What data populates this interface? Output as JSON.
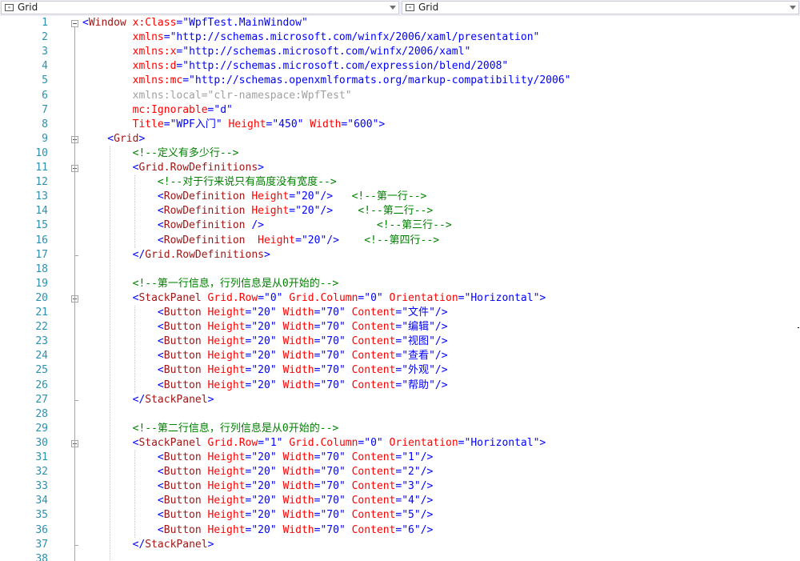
{
  "navbar": {
    "left_combo": {
      "icon": "xaml-element-icon",
      "label": "Grid"
    },
    "right_combo": {
      "icon": "xaml-element-icon",
      "label": "Grid"
    }
  },
  "line_numbers": [
    "1",
    "2",
    "3",
    "4",
    "5",
    "6",
    "7",
    "8",
    "9",
    "10",
    "11",
    "12",
    "13",
    "14",
    "15",
    "16",
    "17",
    "18",
    "19",
    "20",
    "21",
    "22",
    "23",
    "24",
    "25",
    "26",
    "27",
    "28",
    "29",
    "30",
    "31",
    "32",
    "33",
    "34",
    "35",
    "36",
    "37",
    "38"
  ],
  "code_lines": [
    [
      [
        "p",
        "<"
      ],
      [
        "el",
        "Window"
      ],
      [
        "at",
        " x:Class"
      ],
      [
        "p",
        "=\""
      ],
      [
        "v",
        "WpfTest.MainWindow"
      ],
      [
        "p",
        "\""
      ]
    ],
    [
      [
        "at",
        "        xmlns"
      ],
      [
        "p",
        "=\""
      ],
      [
        "v",
        "http://schemas.microsoft.com/winfx/2006/xaml/presentation"
      ],
      [
        "p",
        "\""
      ]
    ],
    [
      [
        "at",
        "        xmlns:x"
      ],
      [
        "p",
        "=\""
      ],
      [
        "v",
        "http://schemas.microsoft.com/winfx/2006/xaml"
      ],
      [
        "p",
        "\""
      ]
    ],
    [
      [
        "at",
        "        xmlns:d"
      ],
      [
        "p",
        "=\""
      ],
      [
        "v",
        "http://schemas.microsoft.com/expression/blend/2008"
      ],
      [
        "p",
        "\""
      ]
    ],
    [
      [
        "at",
        "        xmlns:mc"
      ],
      [
        "p",
        "=\""
      ],
      [
        "v",
        "http://schemas.openxmlformats.org/markup-compatibility/2006"
      ],
      [
        "p",
        "\""
      ]
    ],
    [
      [
        "g",
        "        xmlns:local=\"clr-namespace:WpfTest\""
      ]
    ],
    [
      [
        "at",
        "        mc:Ignorable"
      ],
      [
        "p",
        "=\""
      ],
      [
        "v",
        "d"
      ],
      [
        "p",
        "\""
      ]
    ],
    [
      [
        "at",
        "        Title"
      ],
      [
        "p",
        "=\""
      ],
      [
        "v",
        "WPF入门"
      ],
      [
        "p",
        "\""
      ],
      [
        "at",
        " Height"
      ],
      [
        "p",
        "=\""
      ],
      [
        "v",
        "450"
      ],
      [
        "p",
        "\""
      ],
      [
        "at",
        " Width"
      ],
      [
        "p",
        "=\""
      ],
      [
        "v",
        "600"
      ],
      [
        "p",
        "\">"
      ]
    ],
    [
      [
        "p",
        "    <"
      ],
      [
        "el",
        "Grid"
      ],
      [
        "p",
        ">"
      ]
    ],
    [
      [
        "c",
        "        <!--定义有多少行-->"
      ]
    ],
    [
      [
        "p",
        "        <"
      ],
      [
        "el",
        "Grid.RowDefinitions"
      ],
      [
        "p",
        ">"
      ]
    ],
    [
      [
        "c",
        "            <!--对于行来说只有高度没有宽度-->"
      ]
    ],
    [
      [
        "p",
        "            <"
      ],
      [
        "el",
        "RowDefinition"
      ],
      [
        "at",
        " Height"
      ],
      [
        "p",
        "=\""
      ],
      [
        "v",
        "20"
      ],
      [
        "p",
        "\"/>"
      ],
      [
        "t",
        "   "
      ],
      [
        "c",
        "<!--第一行-->"
      ]
    ],
    [
      [
        "p",
        "            <"
      ],
      [
        "el",
        "RowDefinition"
      ],
      [
        "at",
        " Height"
      ],
      [
        "p",
        "=\""
      ],
      [
        "v",
        "20"
      ],
      [
        "p",
        "\"/>"
      ],
      [
        "t",
        "    "
      ],
      [
        "c",
        "<!--第二行-->"
      ]
    ],
    [
      [
        "p",
        "            <"
      ],
      [
        "el",
        "RowDefinition"
      ],
      [
        "p",
        " />"
      ],
      [
        "t",
        "                  "
      ],
      [
        "c",
        "<!--第三行-->"
      ]
    ],
    [
      [
        "p",
        "            <"
      ],
      [
        "el",
        "RowDefinition"
      ],
      [
        "at",
        "  Height"
      ],
      [
        "p",
        "=\""
      ],
      [
        "v",
        "20"
      ],
      [
        "p",
        "\"/>"
      ],
      [
        "t",
        "    "
      ],
      [
        "c",
        "<!--第四行-->"
      ]
    ],
    [
      [
        "p",
        "        </"
      ],
      [
        "el",
        "Grid.RowDefinitions"
      ],
      [
        "p",
        ">"
      ]
    ],
    [
      [
        "t",
        ""
      ]
    ],
    [
      [
        "c",
        "        <!--第一行信息，行列信息是从0开始的-->"
      ]
    ],
    [
      [
        "p",
        "        <"
      ],
      [
        "el",
        "StackPanel"
      ],
      [
        "at",
        " Grid.Row"
      ],
      [
        "p",
        "=\""
      ],
      [
        "v",
        "0"
      ],
      [
        "p",
        "\""
      ],
      [
        "at",
        " Grid.Column"
      ],
      [
        "p",
        "=\""
      ],
      [
        "v",
        "0"
      ],
      [
        "p",
        "\""
      ],
      [
        "at",
        " Orientation"
      ],
      [
        "p",
        "=\""
      ],
      [
        "v",
        "Horizontal"
      ],
      [
        "p",
        "\">"
      ]
    ],
    [
      [
        "p",
        "            <"
      ],
      [
        "el",
        "Button"
      ],
      [
        "at",
        " Height"
      ],
      [
        "p",
        "=\""
      ],
      [
        "v",
        "20"
      ],
      [
        "p",
        "\""
      ],
      [
        "at",
        " Width"
      ],
      [
        "p",
        "=\""
      ],
      [
        "v",
        "70"
      ],
      [
        "p",
        "\""
      ],
      [
        "at",
        " Content"
      ],
      [
        "p",
        "=\""
      ],
      [
        "v",
        "文件"
      ],
      [
        "p",
        "\"/>"
      ]
    ],
    [
      [
        "p",
        "            <"
      ],
      [
        "el",
        "Button"
      ],
      [
        "at",
        " Height"
      ],
      [
        "p",
        "=\""
      ],
      [
        "v",
        "20"
      ],
      [
        "p",
        "\""
      ],
      [
        "at",
        " Width"
      ],
      [
        "p",
        "=\""
      ],
      [
        "v",
        "70"
      ],
      [
        "p",
        "\""
      ],
      [
        "at",
        " Content"
      ],
      [
        "p",
        "=\""
      ],
      [
        "v",
        "编辑"
      ],
      [
        "p",
        "\"/>"
      ]
    ],
    [
      [
        "p",
        "            <"
      ],
      [
        "el",
        "Button"
      ],
      [
        "at",
        " Height"
      ],
      [
        "p",
        "=\""
      ],
      [
        "v",
        "20"
      ],
      [
        "p",
        "\""
      ],
      [
        "at",
        " Width"
      ],
      [
        "p",
        "=\""
      ],
      [
        "v",
        "70"
      ],
      [
        "p",
        "\""
      ],
      [
        "at",
        " Content"
      ],
      [
        "p",
        "=\""
      ],
      [
        "v",
        "视图"
      ],
      [
        "p",
        "\"/>"
      ]
    ],
    [
      [
        "p",
        "            <"
      ],
      [
        "el",
        "Button"
      ],
      [
        "at",
        " Height"
      ],
      [
        "p",
        "=\""
      ],
      [
        "v",
        "20"
      ],
      [
        "p",
        "\""
      ],
      [
        "at",
        " Width"
      ],
      [
        "p",
        "=\""
      ],
      [
        "v",
        "70"
      ],
      [
        "p",
        "\""
      ],
      [
        "at",
        " Content"
      ],
      [
        "p",
        "=\""
      ],
      [
        "v",
        "查看"
      ],
      [
        "p",
        "\"/>"
      ]
    ],
    [
      [
        "p",
        "            <"
      ],
      [
        "el",
        "Button"
      ],
      [
        "at",
        " Height"
      ],
      [
        "p",
        "=\""
      ],
      [
        "v",
        "20"
      ],
      [
        "p",
        "\""
      ],
      [
        "at",
        " Width"
      ],
      [
        "p",
        "=\""
      ],
      [
        "v",
        "70"
      ],
      [
        "p",
        "\""
      ],
      [
        "at",
        " Content"
      ],
      [
        "p",
        "=\""
      ],
      [
        "v",
        "外观"
      ],
      [
        "p",
        "\"/>"
      ]
    ],
    [
      [
        "p",
        "            <"
      ],
      [
        "el",
        "Button"
      ],
      [
        "at",
        " Height"
      ],
      [
        "p",
        "=\""
      ],
      [
        "v",
        "20"
      ],
      [
        "p",
        "\""
      ],
      [
        "at",
        " Width"
      ],
      [
        "p",
        "=\""
      ],
      [
        "v",
        "70"
      ],
      [
        "p",
        "\""
      ],
      [
        "at",
        " Content"
      ],
      [
        "p",
        "=\""
      ],
      [
        "v",
        "帮助"
      ],
      [
        "p",
        "\"/>"
      ]
    ],
    [
      [
        "p",
        "        </"
      ],
      [
        "el",
        "StackPanel"
      ],
      [
        "p",
        ">"
      ]
    ],
    [
      [
        "t",
        ""
      ]
    ],
    [
      [
        "c",
        "        <!--第二行信息，行列信息是从0开始的-->"
      ]
    ],
    [
      [
        "p",
        "        <"
      ],
      [
        "el",
        "StackPanel"
      ],
      [
        "at",
        " Grid.Row"
      ],
      [
        "p",
        "=\""
      ],
      [
        "v",
        "1"
      ],
      [
        "p",
        "\""
      ],
      [
        "at",
        " Grid.Column"
      ],
      [
        "p",
        "=\""
      ],
      [
        "v",
        "0"
      ],
      [
        "p",
        "\""
      ],
      [
        "at",
        " Orientation"
      ],
      [
        "p",
        "=\""
      ],
      [
        "v",
        "Horizontal"
      ],
      [
        "p",
        "\">"
      ]
    ],
    [
      [
        "p",
        "            <"
      ],
      [
        "el",
        "Button"
      ],
      [
        "at",
        " Height"
      ],
      [
        "p",
        "=\""
      ],
      [
        "v",
        "20"
      ],
      [
        "p",
        "\""
      ],
      [
        "at",
        " Width"
      ],
      [
        "p",
        "=\""
      ],
      [
        "v",
        "70"
      ],
      [
        "p",
        "\""
      ],
      [
        "at",
        " Content"
      ],
      [
        "p",
        "=\""
      ],
      [
        "v",
        "1"
      ],
      [
        "p",
        "\"/>"
      ]
    ],
    [
      [
        "p",
        "            <"
      ],
      [
        "el",
        "Button"
      ],
      [
        "at",
        " Height"
      ],
      [
        "p",
        "=\""
      ],
      [
        "v",
        "20"
      ],
      [
        "p",
        "\""
      ],
      [
        "at",
        " Width"
      ],
      [
        "p",
        "=\""
      ],
      [
        "v",
        "70"
      ],
      [
        "p",
        "\""
      ],
      [
        "at",
        " Content"
      ],
      [
        "p",
        "=\""
      ],
      [
        "v",
        "2"
      ],
      [
        "p",
        "\"/>"
      ]
    ],
    [
      [
        "p",
        "            <"
      ],
      [
        "el",
        "Button"
      ],
      [
        "at",
        " Height"
      ],
      [
        "p",
        "=\""
      ],
      [
        "v",
        "20"
      ],
      [
        "p",
        "\""
      ],
      [
        "at",
        " Width"
      ],
      [
        "p",
        "=\""
      ],
      [
        "v",
        "70"
      ],
      [
        "p",
        "\""
      ],
      [
        "at",
        " Content"
      ],
      [
        "p",
        "=\""
      ],
      [
        "v",
        "3"
      ],
      [
        "p",
        "\"/>"
      ]
    ],
    [
      [
        "p",
        "            <"
      ],
      [
        "el",
        "Button"
      ],
      [
        "at",
        " Height"
      ],
      [
        "p",
        "=\""
      ],
      [
        "v",
        "20"
      ],
      [
        "p",
        "\""
      ],
      [
        "at",
        " Width"
      ],
      [
        "p",
        "=\""
      ],
      [
        "v",
        "70"
      ],
      [
        "p",
        "\""
      ],
      [
        "at",
        " Content"
      ],
      [
        "p",
        "=\""
      ],
      [
        "v",
        "4"
      ],
      [
        "p",
        "\"/>"
      ]
    ],
    [
      [
        "p",
        "            <"
      ],
      [
        "el",
        "Button"
      ],
      [
        "at",
        " Height"
      ],
      [
        "p",
        "=\""
      ],
      [
        "v",
        "20"
      ],
      [
        "p",
        "\""
      ],
      [
        "at",
        " Width"
      ],
      [
        "p",
        "=\""
      ],
      [
        "v",
        "70"
      ],
      [
        "p",
        "\""
      ],
      [
        "at",
        " Content"
      ],
      [
        "p",
        "=\""
      ],
      [
        "v",
        "5"
      ],
      [
        "p",
        "\"/>"
      ]
    ],
    [
      [
        "p",
        "            <"
      ],
      [
        "el",
        "Button"
      ],
      [
        "at",
        " Height"
      ],
      [
        "p",
        "=\""
      ],
      [
        "v",
        "20"
      ],
      [
        "p",
        "\""
      ],
      [
        "at",
        " Width"
      ],
      [
        "p",
        "=\""
      ],
      [
        "v",
        "70"
      ],
      [
        "p",
        "\""
      ],
      [
        "at",
        " Content"
      ],
      [
        "p",
        "=\""
      ],
      [
        "v",
        "6"
      ],
      [
        "p",
        "\"/>"
      ]
    ],
    [
      [
        "p",
        "        </"
      ],
      [
        "el",
        "StackPanel"
      ],
      [
        "p",
        ">"
      ]
    ],
    [
      [
        "t",
        ""
      ]
    ]
  ],
  "fold_markers": [
    1,
    9,
    11,
    20,
    30
  ],
  "colors": {
    "line_number": "#2b91af",
    "element": "#a31515",
    "attribute": "#ff0000",
    "attribute_value": "#0000ff",
    "comment": "#008000",
    "unused_namespace": "#a0a0a0"
  }
}
